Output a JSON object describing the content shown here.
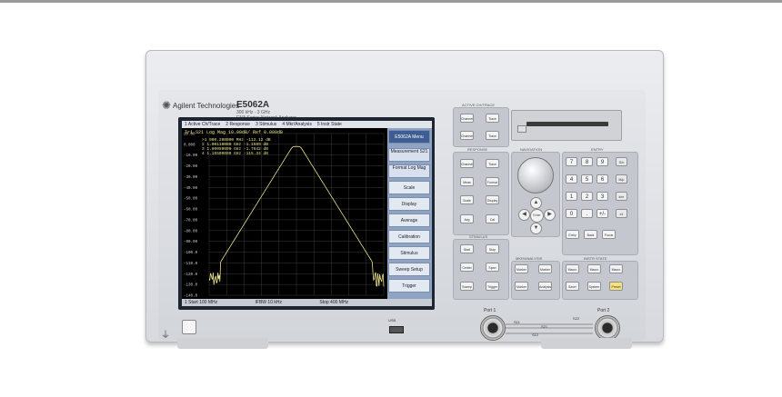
{
  "instrument": {
    "brand": "Agilent Technologies",
    "model": "E5062A",
    "model_sub": "300 kHz - 3 GHz",
    "model_sub2": "ENA Series Network Analyzer"
  },
  "screen": {
    "menu": [
      "1 Active Ch/Trace",
      "2 Response",
      "3 Stimulus",
      "4 Mkr/Analysis",
      "5 Instr State"
    ],
    "trace_header": "Tr1 S21 Log Mag 10.00dB/ Ref 0.000dB",
    "markers": [
      ">1  900.200000 MHz  -112.12 dB",
      " 2  1.00110000 GHz  -1.1599 dB",
      " 3  1.00050000 GHz  -1.7642 dB",
      " 4  1.16500000 GHz  -115.34 dB"
    ],
    "y_ticks": [
      "10.00",
      "0.000",
      "-10.00",
      "-20.00",
      "-30.00",
      "-40.00",
      "-50.00",
      "-60.00",
      "-70.00",
      "-80.00",
      "-90.00",
      "-100.0",
      "-110.0",
      "-120.0",
      "-130.0",
      "-140.0"
    ],
    "status_start": "1 Start 100 MHz",
    "status_ifbw": "IFBW 10 kHz",
    "status_stop": "Stop 400 MHz"
  },
  "softkeys": {
    "title": "E5062A Menu",
    "items": [
      "Measurement S21",
      "Format Log Mag",
      "Scale",
      "Display",
      "Average",
      "Calibration",
      "Stimulus",
      "Sweep Setup",
      "Trigger"
    ]
  },
  "panel": {
    "active_ch_label": "ACTIVE CH/TRACE",
    "response_label": "RESPONSE",
    "navigation_label": "NAVIGATION",
    "entry_label": "ENTRY",
    "stimulus_label": "STIMULUS",
    "mkr_label": "MKR/ANALYSIS",
    "instr_label": "INSTR STATE",
    "keys": {
      "channel_next": "Channel Next",
      "channel_prev": "Channel Prev",
      "trace_next": "Trace Next",
      "trace_prev": "Trace Prev",
      "channel_max": "Channel Max",
      "trace_max": "Trace Max",
      "meas": "Meas",
      "format": "Format",
      "scale": "Scale",
      "display": "Display",
      "avg": "Avg",
      "cal": "Cal",
      "start": "Start",
      "stop": "Stop",
      "center": "Center",
      "span": "Span",
      "sweep_setup": "Sweep Setup",
      "trigger": "Trigger",
      "marker": "Marker",
      "marker_search": "Marker Search",
      "marker_fctn": "Marker Fctn",
      "analysis": "Analysis",
      "macro_setup": "Macro Setup",
      "macro_run": "Macro Run",
      "macro_break": "Macro Break",
      "save_recall": "Save/ Recall",
      "system": "System",
      "preset": "Preset",
      "entry_off": "Entry Off",
      "back_space": "Back Space",
      "focus": "Focus",
      "enter": "Enter",
      "digits": [
        "7",
        "8",
        "9",
        "4",
        "5",
        "6",
        "1",
        "2",
        "3",
        "0",
        ".",
        "+/-"
      ],
      "units": [
        "G/n",
        "M/μ",
        "k/m",
        "x1"
      ]
    },
    "port1": "Port 1",
    "port2": "Port 2",
    "s11": "S11",
    "s21": "S21",
    "s12": "S12",
    "s22": "S22",
    "usb": "USB"
  },
  "colors": {
    "trace": "#e9e28a",
    "grid": "#4a4a4a",
    "softkey_title": "#3e5d93"
  }
}
